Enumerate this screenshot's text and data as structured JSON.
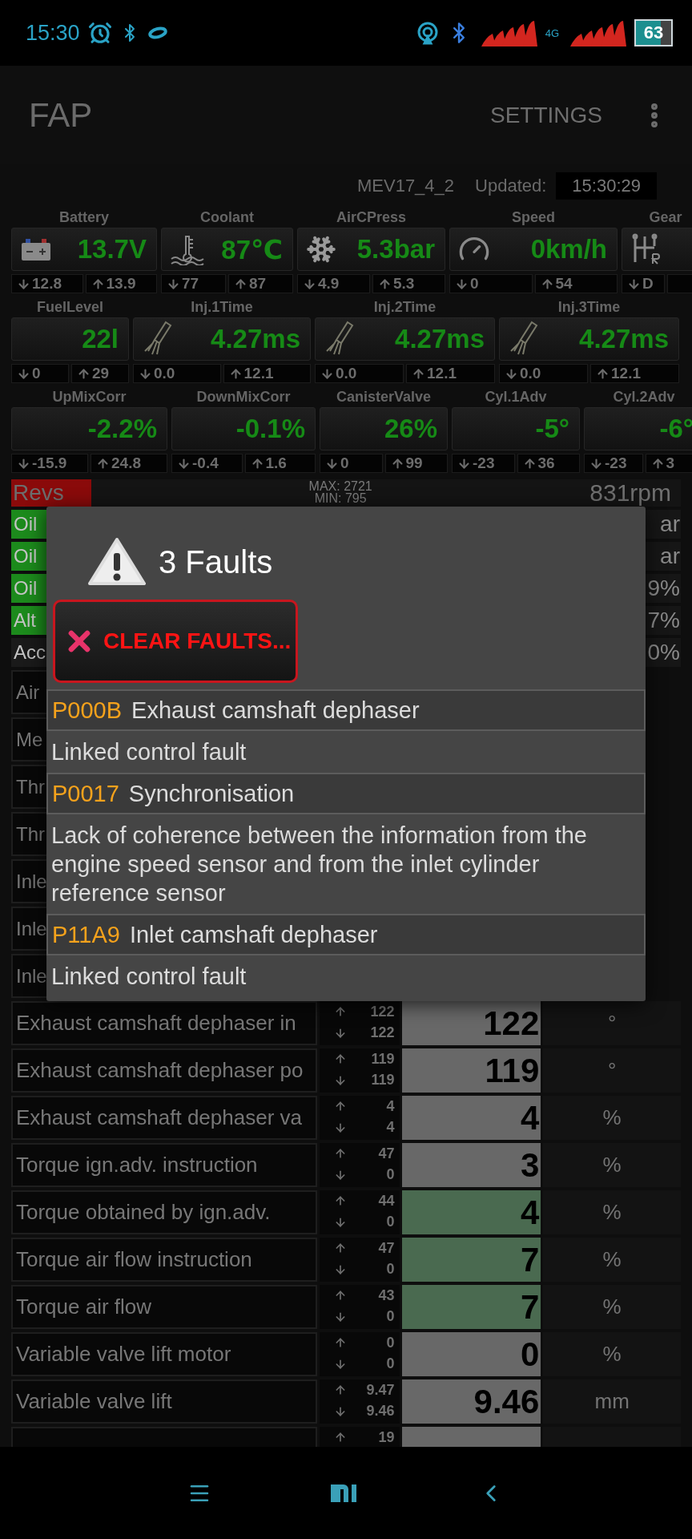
{
  "status_bar": {
    "time": "15:30",
    "network": "4G",
    "battery": "63"
  },
  "app_bar": {
    "title": "FAP",
    "action": "SETTINGS"
  },
  "info": {
    "ecu": "MEV17_4_2",
    "updated_label": "Updated:",
    "updated_time": "15:30:29"
  },
  "gauge_rows": [
    [
      {
        "label": "Battery",
        "kind": "battery",
        "value": "13.7V",
        "min": "12.8",
        "max": "13.9"
      },
      {
        "label": "Coolant",
        "kind": "thermometer",
        "value": "87℃",
        "min": "77",
        "max": "87"
      },
      {
        "label": "AirCPress",
        "kind": "snowflake",
        "value": "5.3bar",
        "min": "4.9",
        "max": "5.3"
      },
      {
        "label": "Speed",
        "kind": "speedometer",
        "value": "0km/h",
        "min": "0",
        "max": "54"
      },
      {
        "label": "Gear",
        "kind": "gearshift",
        "min": "D"
      }
    ],
    [
      {
        "label": "FuelLevel",
        "kind": "plain",
        "value": "22l",
        "min": "0",
        "max": "29"
      },
      {
        "label": "Inj.1Time",
        "kind": "injector",
        "value": "4.27ms",
        "min": "0.0",
        "max": "12.1"
      },
      {
        "label": "Inj.2Time",
        "kind": "injector",
        "value": "4.27ms",
        "min": "0.0",
        "max": "12.1"
      },
      {
        "label": "Inj.3Time",
        "kind": "injector",
        "value": "4.27ms",
        "min": "0.0",
        "max": "12.1"
      }
    ],
    [
      {
        "label": "UpMixCorr",
        "kind": "plain",
        "value": "-2.2%",
        "min": "-15.9",
        "max": "24.8"
      },
      {
        "label": "DownMixCorr",
        "kind": "plain",
        "value": "-0.1%",
        "min": "-0.4",
        "max": "1.6"
      },
      {
        "label": "CanisterValve",
        "kind": "plain",
        "value": "26%",
        "min": "0",
        "max": "99"
      },
      {
        "label": "Cyl.1Adv",
        "kind": "plain",
        "value": "-5°",
        "min": "-23",
        "max": "36"
      },
      {
        "label": "Cyl.2Adv",
        "kind": "plain",
        "value": "-6°",
        "min": "-23",
        "max": "3"
      }
    ]
  ],
  "revs": {
    "label": "Revs",
    "max": "MAX: 2721",
    "min": "MIN: 795",
    "value": "831rpm",
    "color": "#8a0a0a"
  },
  "bars": [
    {
      "label": "Oil",
      "value": "ar",
      "color": "#1c8a1c"
    },
    {
      "label": "Oil",
      "value": "ar",
      "color": "#1c8a1c"
    },
    {
      "label": "Oil",
      "value": "9%",
      "color": "#1c8a1c"
    },
    {
      "label": "Alt",
      "value": "7%",
      "color": "#1c8a1c"
    },
    {
      "label": "Acc",
      "value": "0%",
      "color": "#1a1a1a"
    }
  ],
  "table": [
    {
      "label": "Air"
    },
    {
      "label": "Me"
    },
    {
      "label": "Thr"
    },
    {
      "label": "Thr"
    },
    {
      "label": "Inle"
    },
    {
      "label": "Inle"
    },
    {
      "label": "Inle"
    },
    {
      "label": "Exhaust camshaft dephaser in",
      "max": "122",
      "min": "122",
      "value": "122",
      "unit": "°",
      "highlighted": false
    },
    {
      "label": "Exhaust camshaft dephaser po",
      "max": "119",
      "min": "119",
      "value": "119",
      "unit": "°",
      "highlighted": false
    },
    {
      "label": "Exhaust camshaft dephaser va",
      "max": "4",
      "min": "4",
      "value": "4",
      "unit": "%",
      "highlighted": false
    },
    {
      "label": "Torque ign.adv. instruction",
      "max": "47",
      "min": "0",
      "value": "3",
      "unit": "%",
      "highlighted": false
    },
    {
      "label": "Torque obtained by ign.adv.",
      "max": "44",
      "min": "0",
      "value": "4",
      "unit": "%",
      "highlighted": true
    },
    {
      "label": "Torque air flow instruction",
      "max": "47",
      "min": "0",
      "value": "7",
      "unit": "%",
      "highlighted": true
    },
    {
      "label": "Torque air flow",
      "max": "43",
      "min": "0",
      "value": "7",
      "unit": "%",
      "highlighted": true
    },
    {
      "label": "Variable valve lift motor",
      "max": "0",
      "min": "0",
      "value": "0",
      "unit": "%",
      "highlighted": false
    },
    {
      "label": "Variable valve lift",
      "max": "9.47",
      "min": "9.46",
      "value": "9.46",
      "unit": "mm",
      "highlighted": false
    },
    {
      "max": "19"
    }
  ],
  "dialog": {
    "title": "3 Faults",
    "clear_button": "CLEAR FAULTS...",
    "faults": [
      {
        "code": "P000B",
        "title": "Exhaust camshaft dephaser",
        "description": "Linked control fault"
      },
      {
        "code": "P0017",
        "title": "Synchronisation",
        "description": "Lack of coherence between the information from the engine speed sensor and from the inlet cylinder reference sensor"
      },
      {
        "code": "P11A9",
        "title": "Inlet camshaft dephaser",
        "description": "Linked control fault"
      }
    ]
  }
}
